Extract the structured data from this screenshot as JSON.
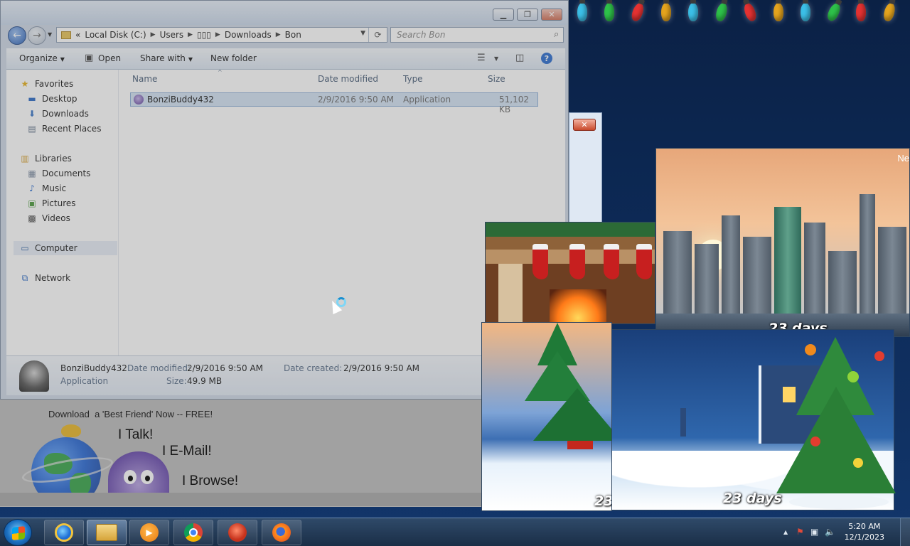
{
  "explorer": {
    "address": {
      "overflow": "«",
      "crumbs": [
        "Local Disk (C:)",
        "Users",
        "▯▯▯",
        "Downloads",
        "Bon"
      ],
      "separator": "▶"
    },
    "search": {
      "placeholder": "Search Bon"
    },
    "toolbar": {
      "organize": "Organize",
      "open": "Open",
      "share_with": "Share with",
      "new_folder": "New folder"
    },
    "nav": {
      "favorites": "Favorites",
      "desktop": "Desktop",
      "downloads": "Downloads",
      "recent_places": "Recent Places",
      "libraries": "Libraries",
      "documents": "Documents",
      "music": "Music",
      "pictures": "Pictures",
      "videos": "Videos",
      "computer": "Computer",
      "network": "Network"
    },
    "columns": {
      "name": "Name",
      "date_modified": "Date modified",
      "type": "Type",
      "size": "Size"
    },
    "files": [
      {
        "name": "BonziBuddy432",
        "date_modified": "2/9/2016 9:50 AM",
        "type": "Application",
        "size": "51,102 KB"
      }
    ],
    "details": {
      "name": "BonziBuddy432",
      "type": "Application",
      "date_modified_label": "Date modified:",
      "date_modified": "2/9/2016 9:50 AM",
      "date_created_label": "Date created:",
      "date_created": "2/9/2016 9:50 AM",
      "size_label": "Size:",
      "size": "49.9 MB"
    }
  },
  "promo": {
    "download": "Download",
    "headline": "a 'Best Friend' Now -- FREE!",
    "talk": "I Talk!",
    "email": "I E-Mail!",
    "browse": "I Browse!"
  },
  "gadgets": {
    "city_corner": "Ne",
    "city_days": "23 days",
    "tree_days": "23",
    "night_days": "23 days"
  },
  "taskbar": {
    "time": "5:20 AM",
    "date": "12/1/2023"
  },
  "colors": {
    "accent": "#2f6fd0",
    "selection": "#d5e3f4",
    "taskbar": "#1a2e47"
  }
}
